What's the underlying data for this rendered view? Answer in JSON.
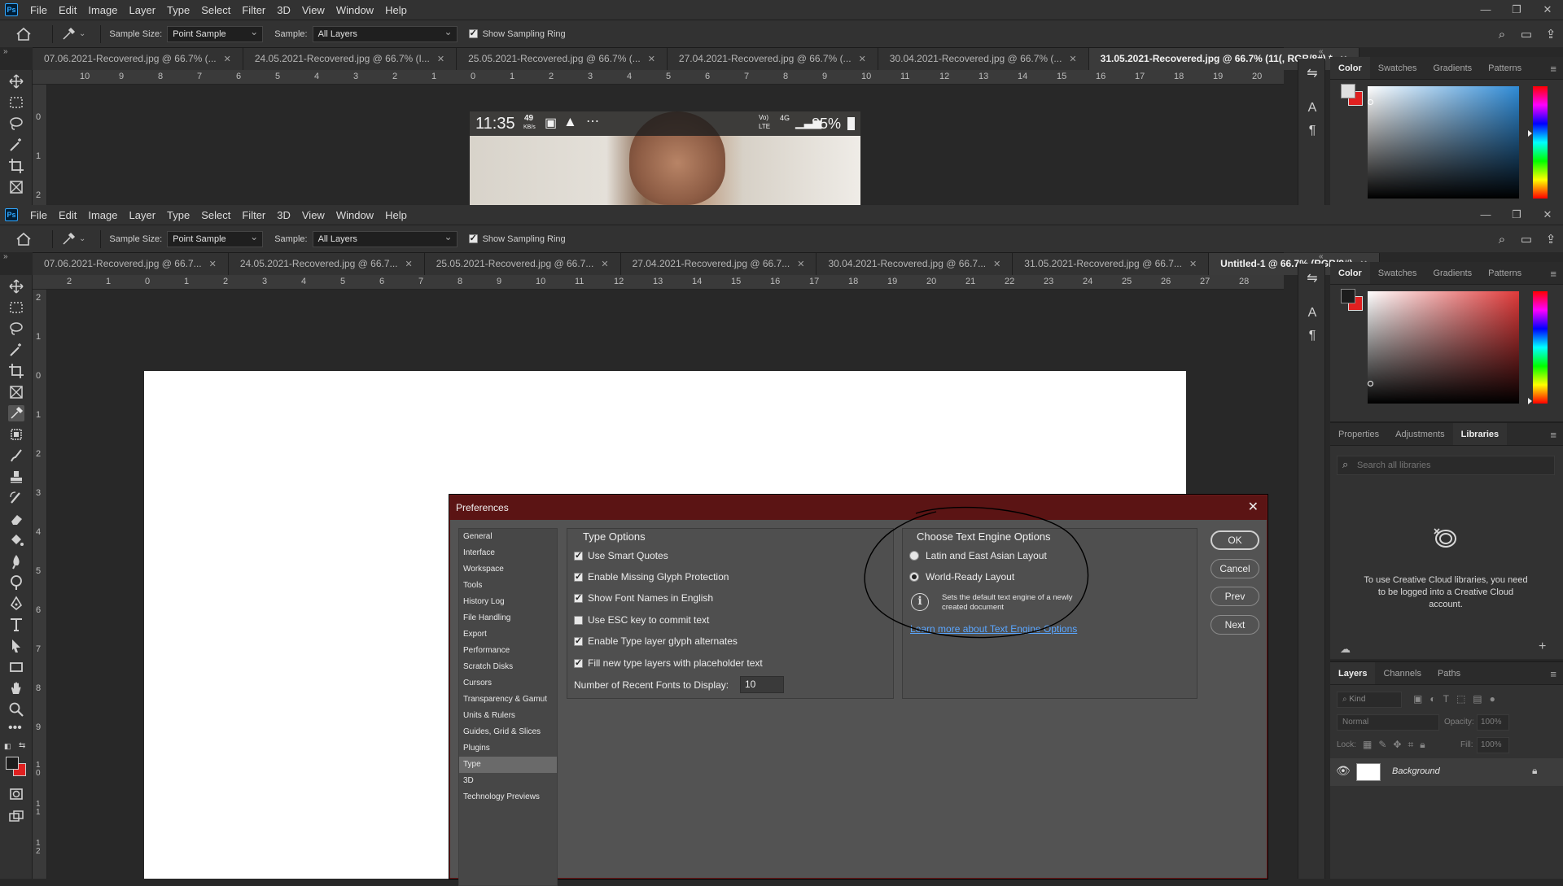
{
  "app": {
    "logo": "Ps"
  },
  "menu": [
    "File",
    "Edit",
    "Image",
    "Layer",
    "Type",
    "Select",
    "Filter",
    "3D",
    "View",
    "Window",
    "Help"
  ],
  "options": {
    "sample_size_label": "Sample Size:",
    "sample_size_value": "Point Sample",
    "sample_label": "Sample:",
    "sample_value": "All Layers",
    "show_ring_label": "Show Sampling Ring"
  },
  "top_window": {
    "tabs": [
      {
        "label": "07.06.2021-Recovered.jpg @ 66.7% (...",
        "active": false
      },
      {
        "label": "24.05.2021-Recovered.jpg @ 66.7% (I...",
        "active": false
      },
      {
        "label": "25.05.2021-Recovered.jpg @ 66.7% (...",
        "active": false
      },
      {
        "label": "27.04.2021-Recovered.jpg @ 66.7% (...",
        "active": false
      },
      {
        "label": "30.04.2021-Recovered.jpg @ 66.7% (...",
        "active": false
      },
      {
        "label": "31.05.2021-Recovered.jpg @ 66.7% (11(, RGB/8#) *",
        "active": true
      }
    ],
    "ruler_h": [
      "10",
      "9",
      "8",
      "7",
      "6",
      "5",
      "4",
      "3",
      "2",
      "1",
      "0",
      "1",
      "2",
      "3",
      "4",
      "5",
      "6",
      "7",
      "8",
      "9",
      "10",
      "11",
      "12",
      "13",
      "14",
      "15",
      "16",
      "17",
      "18",
      "19",
      "20"
    ],
    "ruler_v": [
      "0",
      "1",
      "2"
    ],
    "phone_status": {
      "time": "11:35",
      "speed_top": "49",
      "speed_bottom": "KB/s",
      "net1": "Vo)",
      "net2": "LTE",
      "net3": "4G",
      "battery": "85%"
    }
  },
  "bottom_window": {
    "tabs": [
      {
        "label": "07.06.2021-Recovered.jpg @ 66.7...",
        "active": false
      },
      {
        "label": "24.05.2021-Recovered.jpg @ 66.7...",
        "active": false
      },
      {
        "label": "25.05.2021-Recovered.jpg @ 66.7...",
        "active": false
      },
      {
        "label": "27.04.2021-Recovered.jpg @ 66.7...",
        "active": false
      },
      {
        "label": "30.04.2021-Recovered.jpg @ 66.7...",
        "active": false
      },
      {
        "label": "31.05.2021-Recovered.jpg @ 66.7...",
        "active": false
      },
      {
        "label": "Untitled-1 @ 66.7% (RGB/8#)",
        "active": true
      }
    ],
    "ruler_h": [
      "2",
      "1",
      "0",
      "1",
      "2",
      "3",
      "4",
      "5",
      "6",
      "7",
      "8",
      "9",
      "10",
      "11",
      "12",
      "13",
      "14",
      "15",
      "16",
      "17",
      "18",
      "19",
      "20",
      "21",
      "22",
      "23",
      "24",
      "25",
      "26",
      "27",
      "28"
    ],
    "ruler_v": [
      "2",
      "1",
      "0",
      "1",
      "2",
      "3",
      "4",
      "5",
      "6",
      "7",
      "8",
      "9",
      "1 0",
      "1 1",
      "1 2"
    ]
  },
  "panels": {
    "color_tabs": [
      "Color",
      "Swatches",
      "Gradients",
      "Patterns"
    ],
    "props_tabs": [
      "Properties",
      "Adjustments",
      "Libraries"
    ],
    "libraries": {
      "search_placeholder": "Search all libraries",
      "message": "To use Creative Cloud libraries, you need to be logged into a Creative Cloud account."
    },
    "layers_tabs": [
      "Layers",
      "Channels",
      "Paths"
    ],
    "layers": {
      "kind_placeholder": "Kind",
      "blend_mode": "Normal",
      "opacity_label": "Opacity:",
      "opacity_value": "100%",
      "lock_label": "Lock:",
      "fill_label": "Fill:",
      "fill_value": "100%",
      "layer_name": "Background"
    },
    "colors": {
      "top_fg": "#e0e0e0",
      "top_bg": "#e02020",
      "top_field_hue": "#2f8bd6",
      "bottom_fg": "#1c1c1c",
      "bottom_bg": "#e02020",
      "bottom_field_hue": "#e03a3a"
    }
  },
  "dialog": {
    "title": "Preferences",
    "nav": [
      "General",
      "Interface",
      "Workspace",
      "Tools",
      "History Log",
      "File Handling",
      "Export",
      "Performance",
      "Scratch Disks",
      "Cursors",
      "Transparency & Gamut",
      "Units & Rulers",
      "Guides, Grid & Slices",
      "Plugins",
      "Type",
      "3D",
      "Technology Previews"
    ],
    "nav_selected": "Type",
    "type_options": {
      "title": "Type Options",
      "items": [
        {
          "label": "Use Smart Quotes",
          "checked": true
        },
        {
          "label": "Enable Missing Glyph Protection",
          "checked": true
        },
        {
          "label": "Show Font Names in English",
          "checked": true
        },
        {
          "label": "Use ESC key to commit text",
          "checked": false
        },
        {
          "label": "Enable Type layer glyph alternates",
          "checked": true
        },
        {
          "label": "Fill new type layers with placeholder text",
          "checked": true
        }
      ],
      "recent_fonts_label": "Number of Recent Fonts to Display:",
      "recent_fonts_value": "10"
    },
    "engine": {
      "title": "Choose Text Engine Options",
      "options": [
        {
          "label": "Latin and East Asian Layout",
          "selected": false
        },
        {
          "label": "World-Ready Layout",
          "selected": true
        }
      ],
      "info": "Sets the default text engine of a newly created document",
      "link": "Learn more about Text Engine Options"
    },
    "buttons": {
      "ok": "OK",
      "cancel": "Cancel",
      "prev": "Prev",
      "next": "Next"
    }
  }
}
